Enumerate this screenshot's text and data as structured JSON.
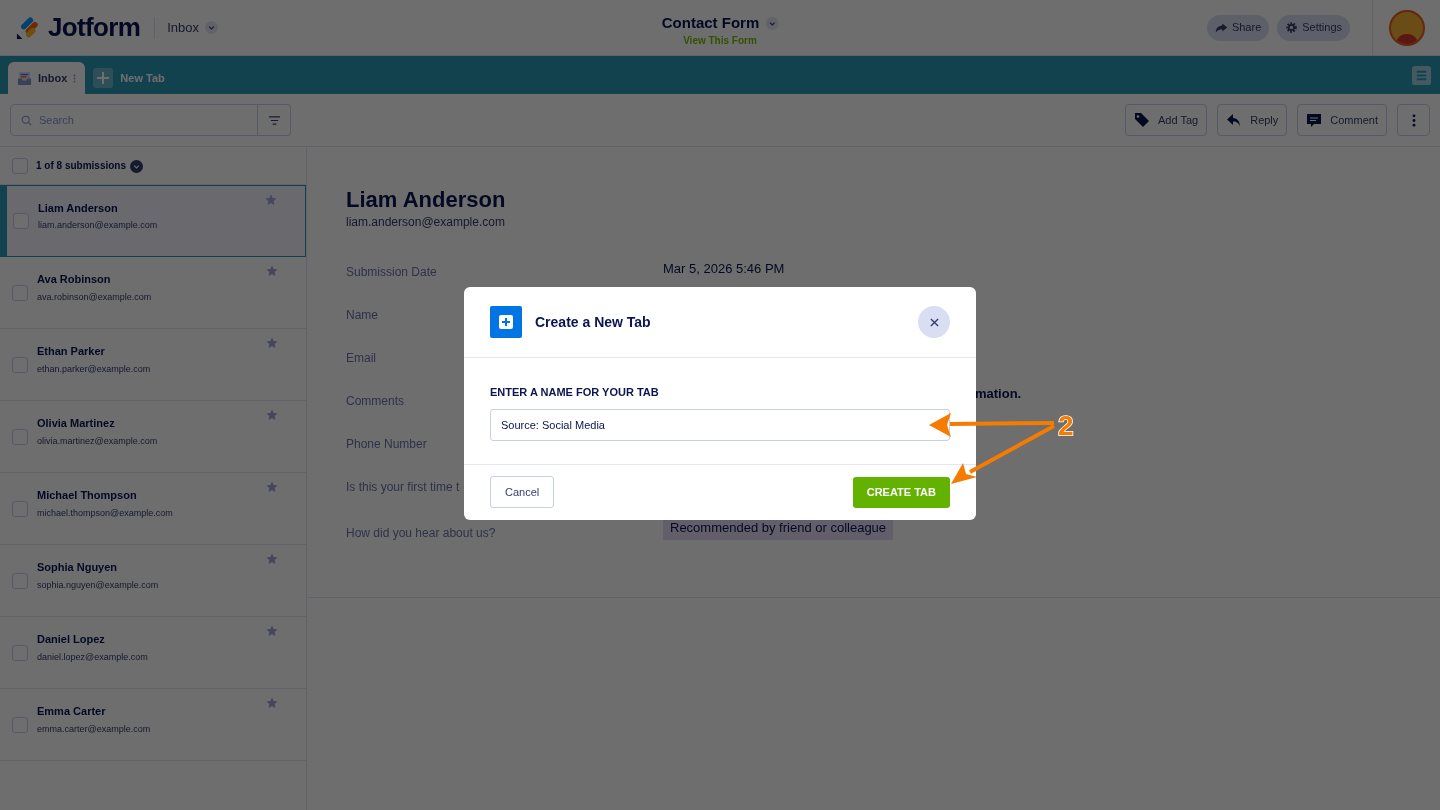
{
  "header": {
    "logo": "Jotform",
    "section": "Inbox",
    "form_title": "Contact Form",
    "form_link": "View This Form",
    "buttons": [
      {
        "label": "Share",
        "kind": "share"
      },
      {
        "label": "Settings",
        "kind": "settings"
      }
    ]
  },
  "tab_bar": {
    "tabs": [
      {
        "label": "Inbox",
        "selected": true
      }
    ],
    "new_tab": "New Tab"
  },
  "toolbar": {
    "search": {
      "placeholder": "Search"
    },
    "actions": [
      {
        "label": "Add Tag",
        "kind": "tag"
      },
      {
        "label": "Reply",
        "kind": "reply"
      },
      {
        "label": "Comment",
        "kind": "comment"
      }
    ]
  },
  "list": {
    "count": "1 of 8 submissions",
    "select_all": {
      "checked": false
    },
    "items": [
      {
        "name": "Liam Anderson",
        "email": "liam.anderson@example.com",
        "selected": true,
        "checked": false
      },
      {
        "name": "Ava Robinson",
        "email": "ava.robinson@example.com",
        "selected": false,
        "checked": false
      },
      {
        "name": "Ethan Parker",
        "email": "ethan.parker@example.com",
        "selected": false,
        "checked": false
      },
      {
        "name": "Olivia Martinez",
        "email": "olivia.martinez@example.com",
        "selected": false,
        "checked": false
      },
      {
        "name": "Michael Thompson",
        "email": "michael.thompson@example.com",
        "selected": false,
        "checked": false
      },
      {
        "name": "Sophia Nguyen",
        "email": "sophia.nguyen@example.com",
        "selected": false,
        "checked": false
      },
      {
        "name": "Daniel Lopez",
        "email": "daniel.lopez@example.com",
        "selected": false,
        "checked": false
      },
      {
        "name": "Emma Carter",
        "email": "emma.carter@example.com",
        "selected": false,
        "checked": false
      }
    ]
  },
  "detail": {
    "name": "Liam Anderson",
    "email": "liam.anderson@example.com",
    "fields": [
      {
        "label": "Submission Date",
        "value": "Mar 5, 2026 5:46 PM",
        "kind": "text"
      },
      {
        "label": "Name",
        "kind": "hidden"
      },
      {
        "label": "Email",
        "kind": "hidden"
      },
      {
        "label": "Comments",
        "value": "mation.",
        "kind": "clipped"
      },
      {
        "label": "Phone Number",
        "kind": "hidden"
      },
      {
        "label": "Is this your first time t",
        "kind": "hidden"
      },
      {
        "label": "How did you hear about us?",
        "value": "Recommended by friend or colleague",
        "kind": "tag"
      }
    ]
  },
  "modal": {
    "title": "Create a New Tab",
    "field_label": "ENTER A NAME FOR YOUR TAB",
    "field_value": "Source: Social Media",
    "cancel": "Cancel",
    "submit": "CREATE TAB"
  },
  "annotation": {
    "number": "2"
  }
}
